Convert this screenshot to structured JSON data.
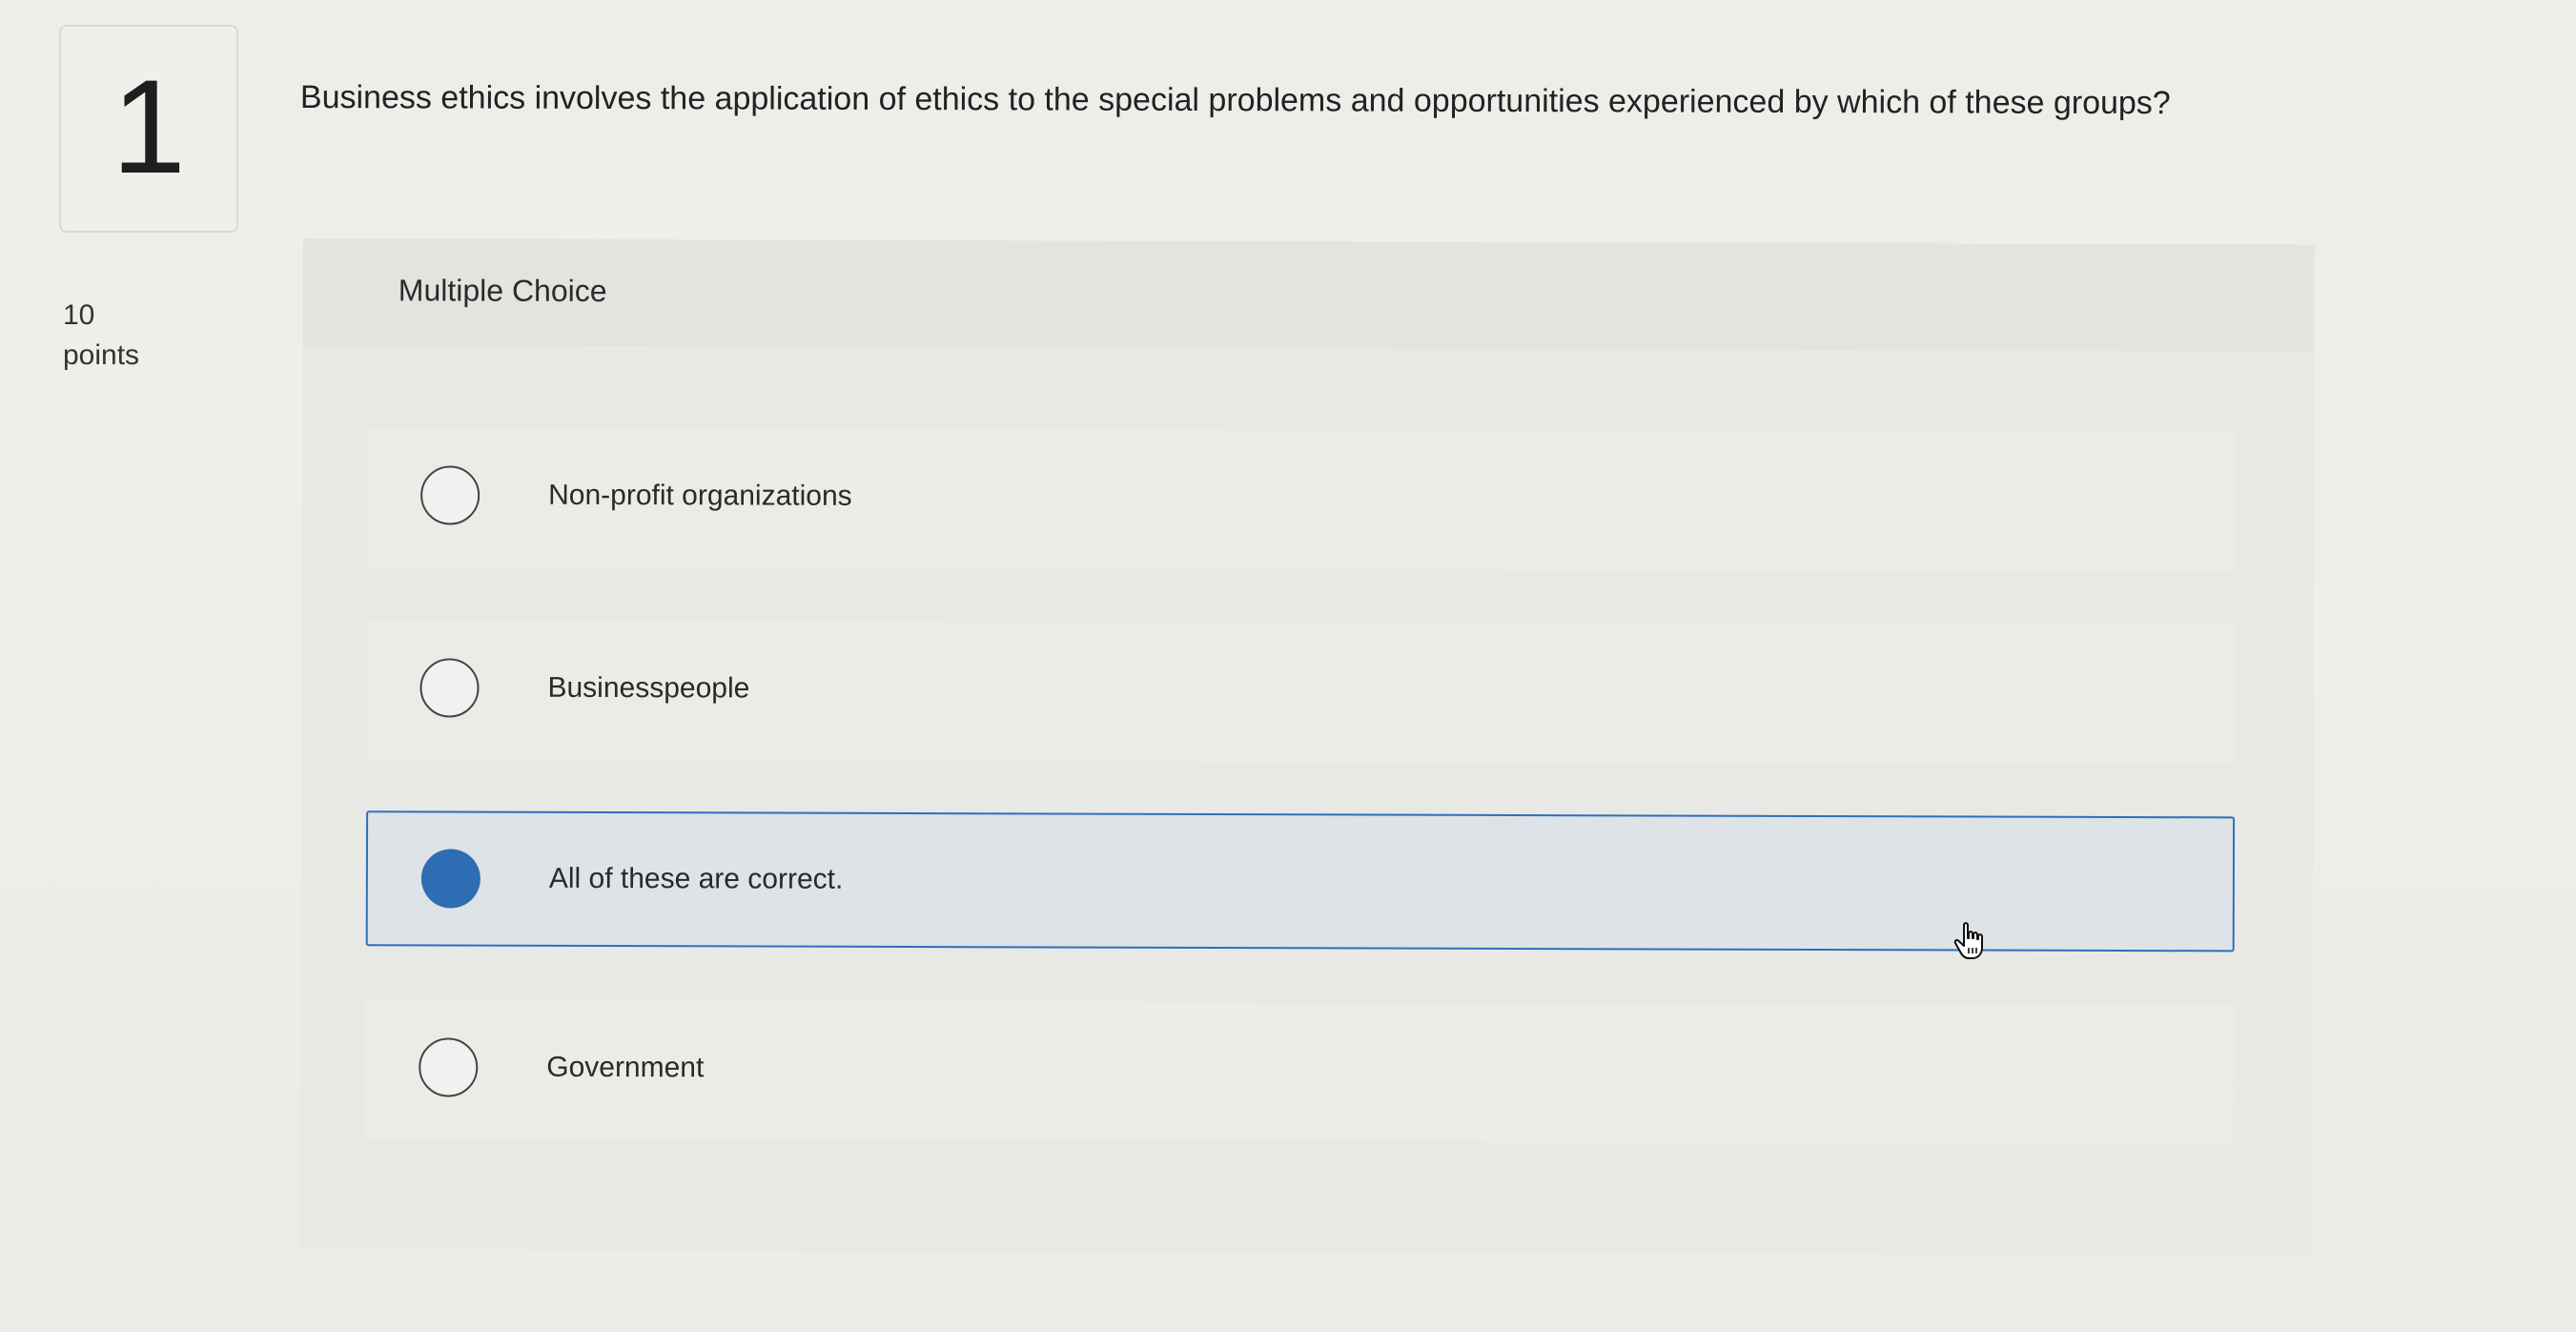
{
  "question": {
    "number": "1",
    "points_value": "10",
    "points_label": "points",
    "text": "Business ethics involves the application of ethics to the special problems and opportunities experienced by which of these groups?",
    "type_label": "Multiple Choice"
  },
  "choices": [
    {
      "label": "Non-profit organizations",
      "selected": false
    },
    {
      "label": "Businesspeople",
      "selected": false
    },
    {
      "label": "All of these are correct.",
      "selected": true
    },
    {
      "label": "Government",
      "selected": false
    }
  ],
  "colors": {
    "selected_radio": "#2e6db4",
    "selected_border": "#2f6fba",
    "selected_background": "#dde3e6"
  },
  "icons": {
    "cursor": "hand-pointer-icon"
  }
}
